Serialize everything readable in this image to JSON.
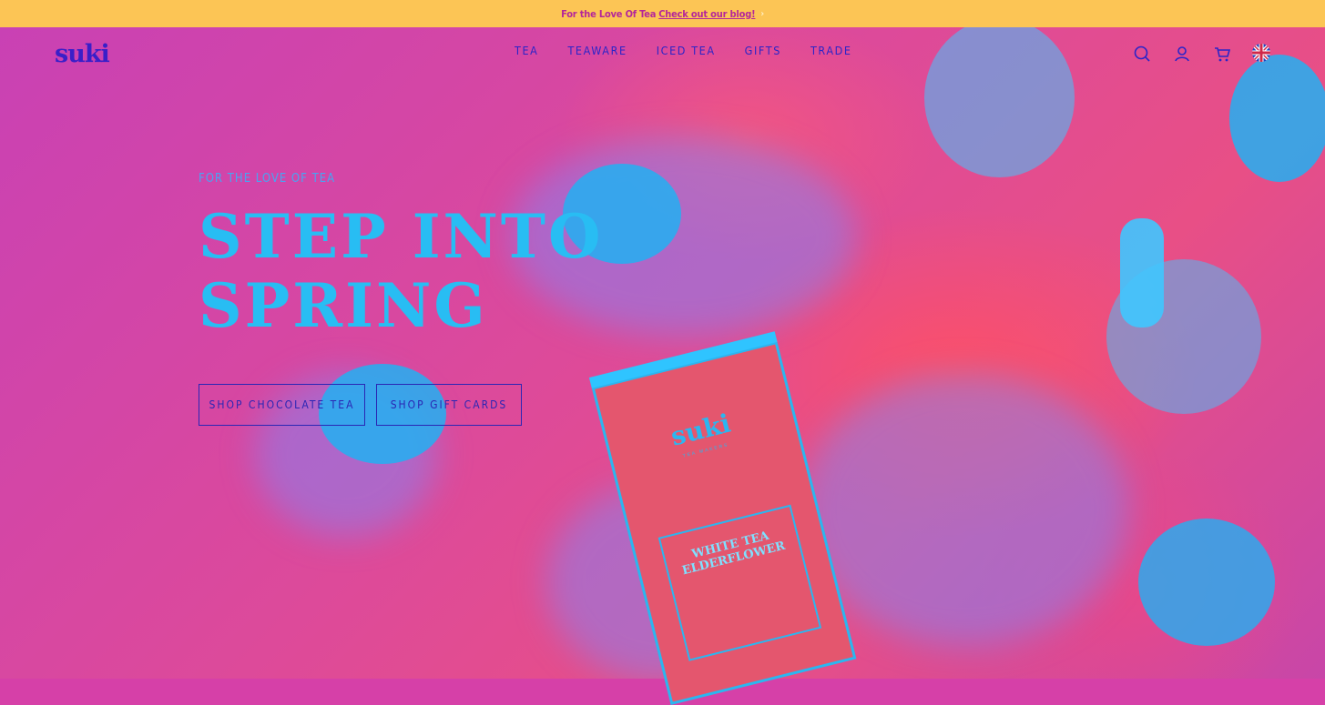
{
  "announcement": {
    "lead": "For the Love Of Tea",
    "link": "Check out our blog!",
    "chevron": "›"
  },
  "brand": {
    "logo": "suki"
  },
  "nav": [
    "TEA",
    "TEAWARE",
    "ICED TEA",
    "GIFTS",
    "TRADE"
  ],
  "header_icons": [
    "search-icon",
    "account-icon",
    "cart-icon",
    "uk-flag-icon"
  ],
  "hero": {
    "eyebrow": "FOR THE LOVE OF TEA",
    "headline_line1": "STEP INTO",
    "headline_line2": "SPRING",
    "buttons": [
      "SHOP CHOCOLATE TEA",
      "SHOP GIFT CARDS"
    ]
  },
  "product_box": {
    "logo": "suki",
    "subtitle": "TEA MAKERS",
    "name_line1": "WHITE TEA",
    "name_line2": "ELDERFLOWER"
  },
  "colors": {
    "announcement_bg": "#fcc555",
    "announcement_text": "#b4269a",
    "hero_bg": "#d640a8",
    "headline": "#28bdf3",
    "nav_text": "#2a24c8"
  }
}
